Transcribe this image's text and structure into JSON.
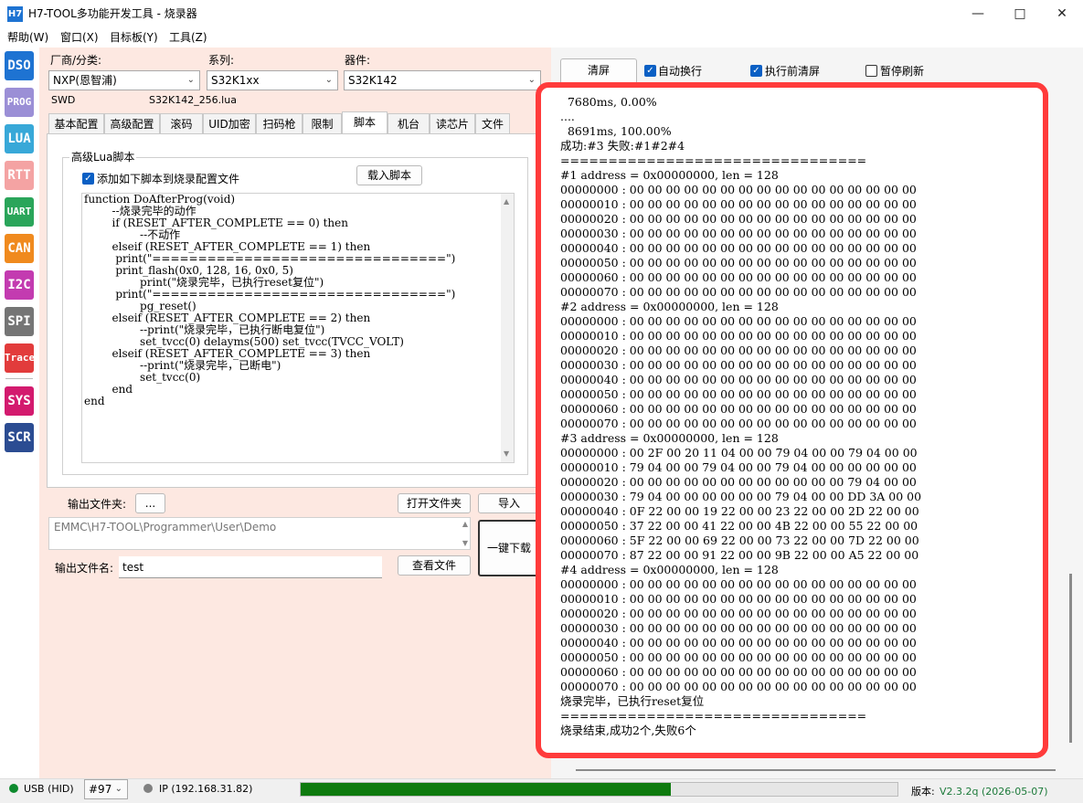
{
  "window": {
    "title": "H7-TOOL多功能开发工具 - 烧录器",
    "icon_text": "H7"
  },
  "menu": [
    "帮助(W)",
    "窗口(X)",
    "目标板(Y)",
    "工具(Z)"
  ],
  "toolbar": [
    {
      "label": "DSO",
      "color": "#1e73d2"
    },
    {
      "label": "PROG",
      "color": "#9b8fd6"
    },
    {
      "label": "LUA",
      "color": "#38a8d8"
    },
    {
      "label": "RTT",
      "color": "#f4a3a3"
    },
    {
      "label": "UART",
      "color": "#2aa55a"
    },
    {
      "label": "CAN",
      "color": "#f08a1e"
    },
    {
      "label": "I2C",
      "color": "#c33bb0"
    },
    {
      "label": "SPI",
      "color": "#757575"
    },
    {
      "label": "Trace",
      "color": "#e23c3c"
    },
    {
      "label": "SYS",
      "color": "#d31a6e"
    },
    {
      "label": "SCR",
      "color": "#2b4c92"
    }
  ],
  "device": {
    "vendor_label": "厂商/分类:",
    "vendor_value": "NXP(恩智浦)",
    "series_label": "系列:",
    "series_value": "S32K1xx",
    "part_label": "器件:",
    "part_value": "S32K142",
    "interface": "SWD",
    "lua_file": "S32K142_256.lua"
  },
  "tabs": [
    "基本配置",
    "高级配置",
    "滚码",
    "UID加密",
    "扫码枪",
    "限制",
    "脚本",
    "机台",
    "读芯片",
    "文件"
  ],
  "active_tab": "脚本",
  "script": {
    "group_title": "高级Lua脚本",
    "checkbox_label": "添加如下脚本到烧录配置文件",
    "load_button": "载入脚本",
    "code": "function DoAfterProg(void)\n        --烧录完毕的动作\n        if (RESET_AFTER_COMPLETE == 0) then\n                --不动作\n        elseif (RESET_AFTER_COMPLETE == 1) then\n         print(\"================================\")\n         print_flash(0x0, 128, 16, 0x0, 5)\n                print(\"烧录完毕，已执行reset复位\")\n         print(\"================================\")\n                pg_reset()\n        elseif (RESET_AFTER_COMPLETE == 2) then\n                --print(\"烧录完毕，已执行断电复位\")\n                set_tvcc(0) delayms(500) set_tvcc(TVCC_VOLT)\n        elseif (RESET_AFTER_COMPLETE == 3) then\n                --print(\"烧录完毕，已断电\")\n                set_tvcc(0)\n        end\nend"
  },
  "output": {
    "folder_label": "输出文件夹:",
    "browse_button": "...",
    "open_folder_button": "打开文件夹",
    "import_button": "导入",
    "path": "EMMC\\H7-TOOL\\Programmer\\User\\Demo",
    "filename_label": "输出文件名:",
    "filename_value": "test",
    "view_file_button": "查看文件",
    "download_button": "一键下载"
  },
  "console": {
    "clear_button": "清屏",
    "auto_wrap_label": "自动换行",
    "auto_wrap": true,
    "clear_before_label": "执行前清屏",
    "clear_before": true,
    "pause_label": "暂停刷新",
    "pause": false,
    "text": "  7680ms, 0.00%\n....\n  8691ms, 100.00%\n成功:#3 失败:#1#2#4\n================================\n#1 address = 0x00000000, len = 128\n00000000 : 00 00 00 00 00 00 00 00 00 00 00 00 00 00 00 00\n00000010 : 00 00 00 00 00 00 00 00 00 00 00 00 00 00 00 00\n00000020 : 00 00 00 00 00 00 00 00 00 00 00 00 00 00 00 00\n00000030 : 00 00 00 00 00 00 00 00 00 00 00 00 00 00 00 00\n00000040 : 00 00 00 00 00 00 00 00 00 00 00 00 00 00 00 00\n00000050 : 00 00 00 00 00 00 00 00 00 00 00 00 00 00 00 00\n00000060 : 00 00 00 00 00 00 00 00 00 00 00 00 00 00 00 00\n00000070 : 00 00 00 00 00 00 00 00 00 00 00 00 00 00 00 00\n#2 address = 0x00000000, len = 128\n00000000 : 00 00 00 00 00 00 00 00 00 00 00 00 00 00 00 00\n00000010 : 00 00 00 00 00 00 00 00 00 00 00 00 00 00 00 00\n00000020 : 00 00 00 00 00 00 00 00 00 00 00 00 00 00 00 00\n00000030 : 00 00 00 00 00 00 00 00 00 00 00 00 00 00 00 00\n00000040 : 00 00 00 00 00 00 00 00 00 00 00 00 00 00 00 00\n00000050 : 00 00 00 00 00 00 00 00 00 00 00 00 00 00 00 00\n00000060 : 00 00 00 00 00 00 00 00 00 00 00 00 00 00 00 00\n00000070 : 00 00 00 00 00 00 00 00 00 00 00 00 00 00 00 00\n#3 address = 0x00000000, len = 128\n00000000 : 00 2F 00 20 11 04 00 00 79 04 00 00 79 04 00 00\n00000010 : 79 04 00 00 79 04 00 00 79 04 00 00 00 00 00 00\n00000020 : 00 00 00 00 00 00 00 00 00 00 00 00 79 04 00 00\n00000030 : 79 04 00 00 00 00 00 00 79 04 00 00 DD 3A 00 00\n00000040 : 0F 22 00 00 19 22 00 00 23 22 00 00 2D 22 00 00\n00000050 : 37 22 00 00 41 22 00 00 4B 22 00 00 55 22 00 00\n00000060 : 5F 22 00 00 69 22 00 00 73 22 00 00 7D 22 00 00\n00000070 : 87 22 00 00 91 22 00 00 9B 22 00 00 A5 22 00 00\n#4 address = 0x00000000, len = 128\n00000000 : 00 00 00 00 00 00 00 00 00 00 00 00 00 00 00 00\n00000010 : 00 00 00 00 00 00 00 00 00 00 00 00 00 00 00 00\n00000020 : 00 00 00 00 00 00 00 00 00 00 00 00 00 00 00 00\n00000030 : 00 00 00 00 00 00 00 00 00 00 00 00 00 00 00 00\n00000040 : 00 00 00 00 00 00 00 00 00 00 00 00 00 00 00 00\n00000050 : 00 00 00 00 00 00 00 00 00 00 00 00 00 00 00 00\n00000060 : 00 00 00 00 00 00 00 00 00 00 00 00 00 00 00 00\n00000070 : 00 00 00 00 00 00 00 00 00 00 00 00 00 00 00 00\n烧录完毕，已执行reset复位\n================================\n烧录结束,成功2个,失败6个"
  },
  "status": {
    "usb_label": "USB (HID)",
    "usb_color": "#0e8a2e",
    "device_num": "#97",
    "ip_label": "IP (192.168.31.82)",
    "ip_color": "#808080",
    "progress_fraction": 0.62,
    "progress_color": "#0e7a0e",
    "version_label": "版本:",
    "version_value": "V2.3.2q (2026-05-07)"
  }
}
